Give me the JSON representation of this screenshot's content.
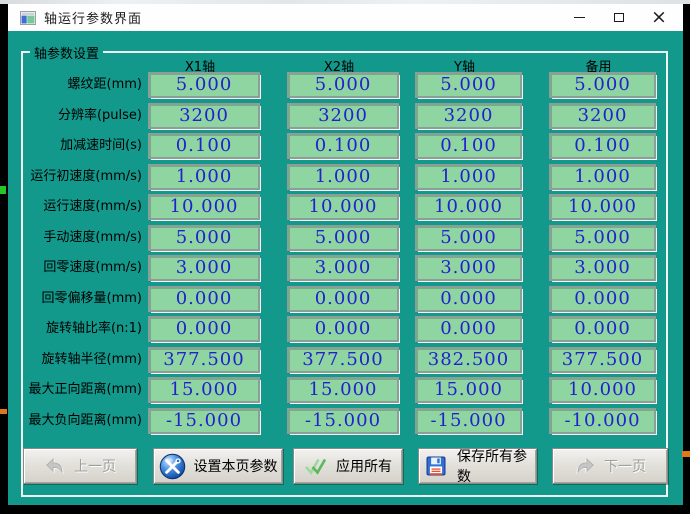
{
  "window": {
    "title": "轴运行参数界面",
    "controls": {
      "minimize": "minimize",
      "maximize": "maximize",
      "close": "close"
    }
  },
  "groupbox": {
    "legend": "轴参数设置"
  },
  "table": {
    "columns": [
      "X1轴",
      "X2轴",
      "Y轴",
      "备用"
    ],
    "rows": [
      {
        "label": "螺纹距(mm)",
        "values": [
          "5.000",
          "5.000",
          "5.000",
          "5.000"
        ]
      },
      {
        "label": "分辨率(pulse)",
        "values": [
          "3200",
          "3200",
          "3200",
          "3200"
        ]
      },
      {
        "label": "加减速时间(s)",
        "values": [
          "0.100",
          "0.100",
          "0.100",
          "0.100"
        ]
      },
      {
        "label": "运行初速度(mm/s)",
        "values": [
          "1.000",
          "1.000",
          "1.000",
          "1.000"
        ]
      },
      {
        "label": "运行速度(mm/s)",
        "values": [
          "10.000",
          "10.000",
          "10.000",
          "10.000"
        ]
      },
      {
        "label": "手动速度(mm/s)",
        "values": [
          "5.000",
          "5.000",
          "5.000",
          "5.000"
        ]
      },
      {
        "label": "回零速度(mm/s)",
        "values": [
          "3.000",
          "3.000",
          "3.000",
          "3.000"
        ]
      },
      {
        "label": "回零偏移量(mm)",
        "values": [
          "0.000",
          "0.000",
          "0.000",
          "0.000"
        ]
      },
      {
        "label": "旋转轴比率(n:1)",
        "values": [
          "0.000",
          "0.000",
          "0.000",
          "0.000"
        ]
      },
      {
        "label": "旋转轴半径(mm)",
        "values": [
          "377.500",
          "377.500",
          "382.500",
          "377.500"
        ]
      },
      {
        "label": "最大正向距离(mm)",
        "values": [
          "15.000",
          "15.000",
          "15.000",
          "10.000"
        ]
      },
      {
        "label": "最大负向距离(mm)",
        "values": [
          "-15.000",
          "-15.000",
          "-15.000",
          "-10.000"
        ]
      }
    ]
  },
  "buttons": [
    {
      "label": "上一页",
      "icon": "undo-arrow-icon",
      "disabled": true
    },
    {
      "label": "设置本页参数",
      "icon": "tools-icon",
      "disabled": false
    },
    {
      "label": "应用所有",
      "icon": "double-check-icon",
      "disabled": false
    },
    {
      "label": "保存所有参数",
      "icon": "floppy-disk-icon",
      "disabled": false
    },
    {
      "label": "下一页",
      "icon": "redo-arrow-icon",
      "disabled": true
    }
  ],
  "colors": {
    "client_background": "#12998c",
    "field_background": "#8fd5a2",
    "value_text": "#2222cc",
    "button_face": "#d6d3cc",
    "titlebar": "#fefefe"
  }
}
